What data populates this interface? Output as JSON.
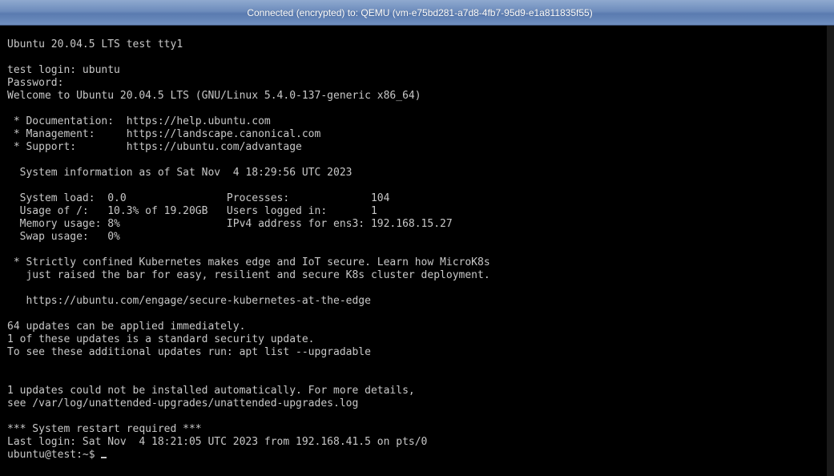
{
  "window": {
    "title": "Connected (encrypted) to: QEMU (vm-e75bd281-a7d8-4fb7-95d9-e1a811835f55)"
  },
  "console": {
    "lines": [
      "Ubuntu 20.04.5 LTS test tty1",
      "",
      "test login: ubuntu",
      "Password:",
      "Welcome to Ubuntu 20.04.5 LTS (GNU/Linux 5.4.0-137-generic x86_64)",
      "",
      " * Documentation:  https://help.ubuntu.com",
      " * Management:     https://landscape.canonical.com",
      " * Support:        https://ubuntu.com/advantage",
      "",
      "  System information as of Sat Nov  4 18:29:56 UTC 2023",
      "",
      "  System load:  0.0                Processes:             104",
      "  Usage of /:   10.3% of 19.20GB   Users logged in:       1",
      "  Memory usage: 8%                 IPv4 address for ens3: 192.168.15.27",
      "  Swap usage:   0%",
      "",
      " * Strictly confined Kubernetes makes edge and IoT secure. Learn how MicroK8s",
      "   just raised the bar for easy, resilient and secure K8s cluster deployment.",
      "",
      "   https://ubuntu.com/engage/secure-kubernetes-at-the-edge",
      "",
      "64 updates can be applied immediately.",
      "1 of these updates is a standard security update.",
      "To see these additional updates run: apt list --upgradable",
      "",
      "",
      "1 updates could not be installed automatically. For more details,",
      "see /var/log/unattended-upgrades/unattended-upgrades.log",
      "",
      "*** System restart required ***",
      "Last login: Sat Nov  4 18:21:05 UTC 2023 from 192.168.41.5 on pts/0"
    ],
    "prompt": "ubuntu@test:~$ "
  }
}
